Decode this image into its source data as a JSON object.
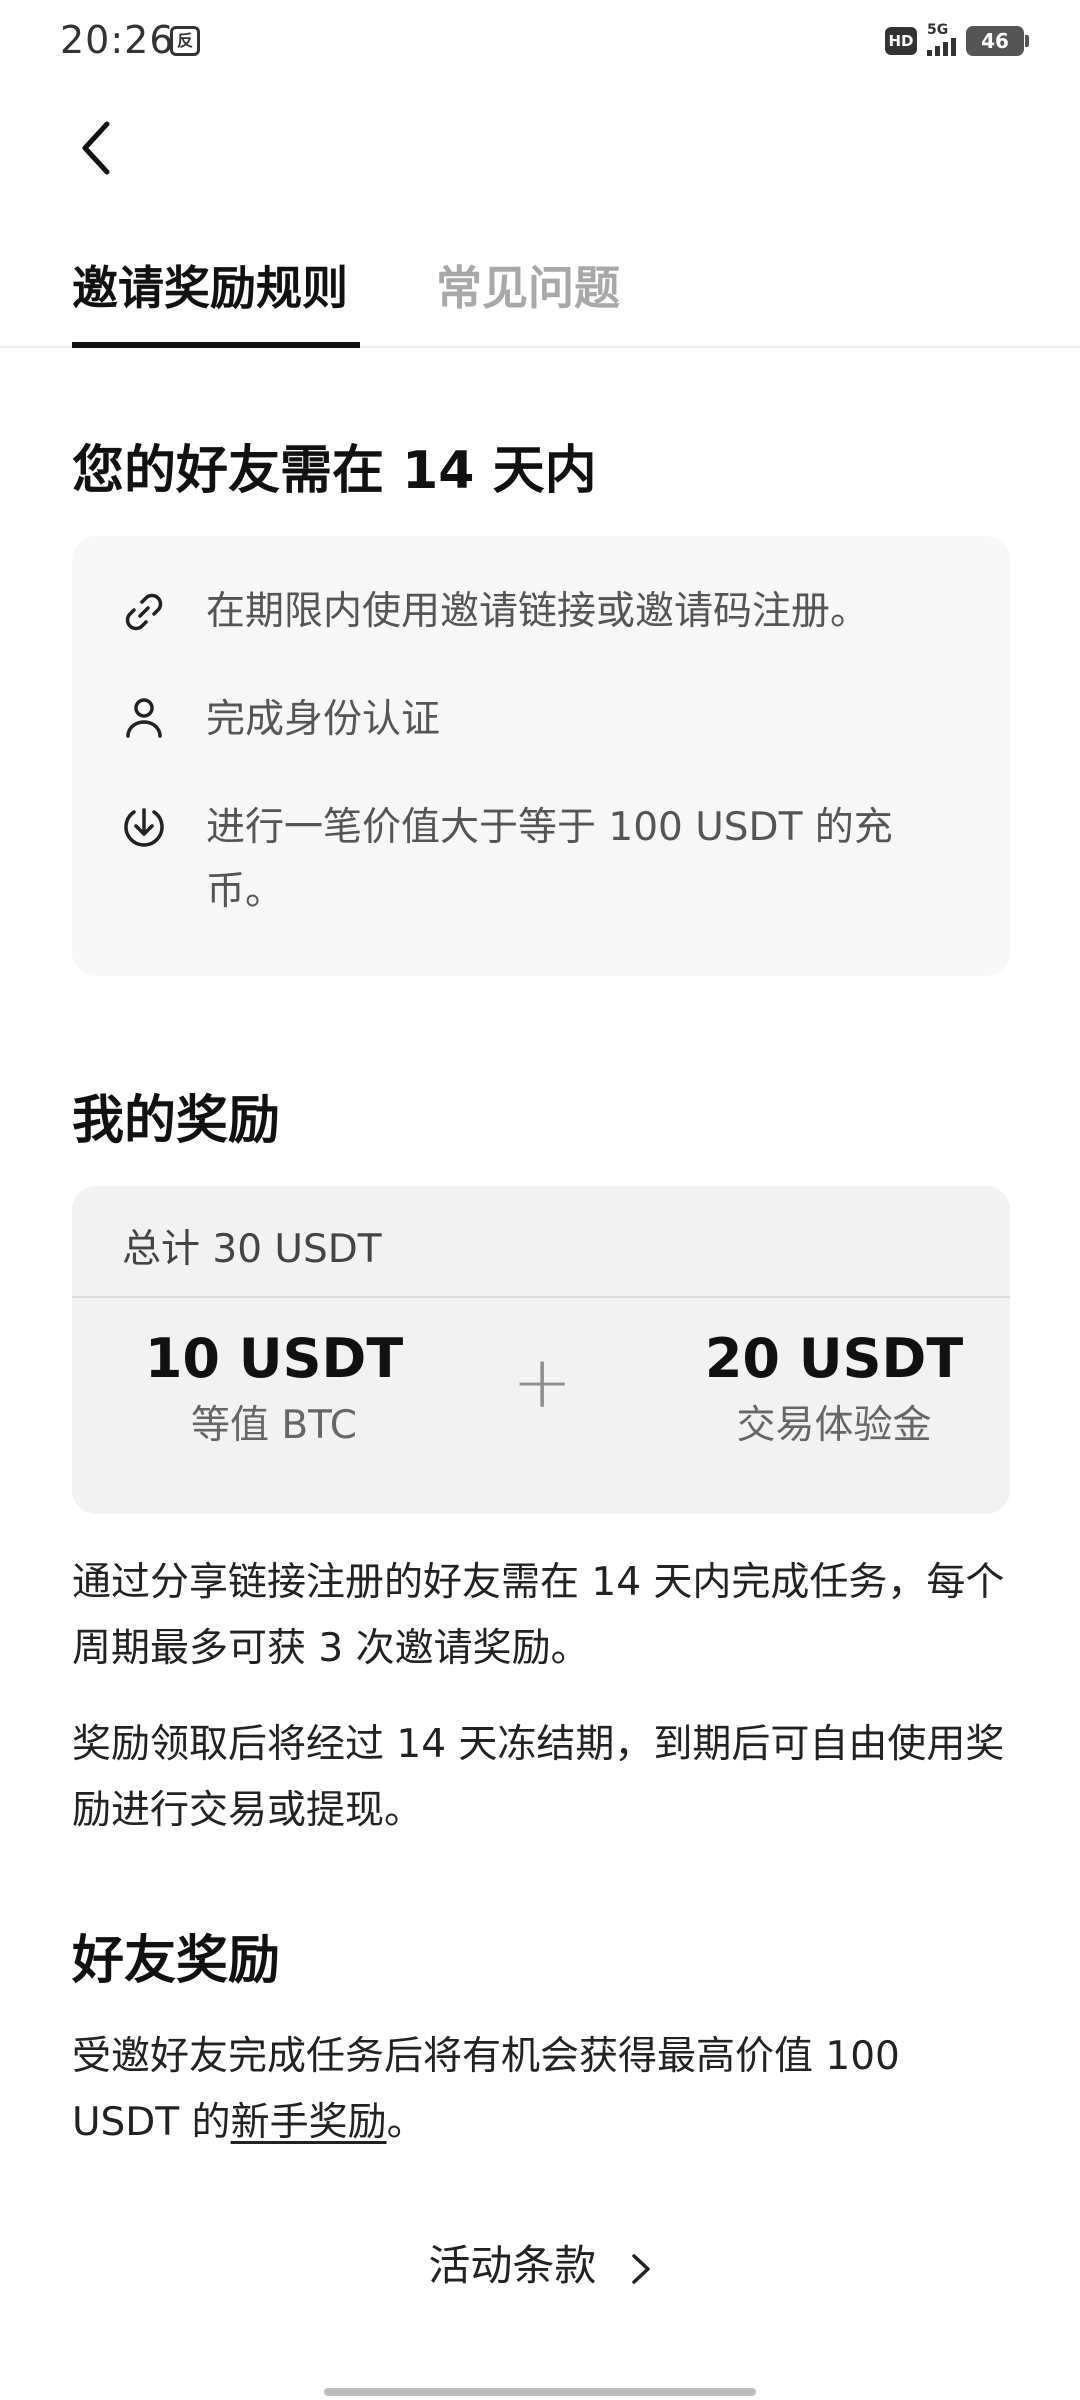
{
  "status_bar": {
    "time": "20:26",
    "app_icon": "反",
    "hd": "HD",
    "network": "5G",
    "battery": "46"
  },
  "header": {
    "back_icon": "chevron-left-icon"
  },
  "tabs": [
    {
      "label": "邀请奖励规则",
      "active": true
    },
    {
      "label": "常见问题",
      "active": false
    }
  ],
  "requirements": {
    "title": "您的好友需在 14 天内",
    "steps": [
      {
        "icon": "link-icon",
        "text": "在期限内使用邀请链接或邀请码注册。"
      },
      {
        "icon": "user-icon",
        "text": "完成身份认证"
      },
      {
        "icon": "deposit-icon",
        "text": "进行一笔价值大于等于 100 USDT 的充币。"
      }
    ]
  },
  "my_rewards": {
    "title": "我的奖励",
    "total": "总计 30 USDT",
    "items": [
      {
        "amount": "10 USDT",
        "desc": "等值 BTC"
      },
      {
        "amount": "20 USDT",
        "desc": "交易体验金"
      }
    ],
    "plus": "+",
    "paragraphs": [
      "通过分享链接注册的好友需在 14 天内完成任务，每个周期最多可获 3 次邀请奖励。",
      "奖励领取后将经过 14 天冻结期，到期后可自由使用奖励进行交易或提现。"
    ]
  },
  "friend_rewards": {
    "title": "好友奖励",
    "text_before": "受邀好友完成任务后将有机会获得最高价值 100 USDT 的",
    "link": "新手奖励",
    "text_after": "。"
  },
  "footer": {
    "terms_label": "活动条款"
  },
  "colors": {
    "text_primary": "#111111",
    "text_inactive_tab": "#a8a8a8",
    "card_bg": "#f7f7f7",
    "reward_card_bg": "#f2f2f2"
  }
}
